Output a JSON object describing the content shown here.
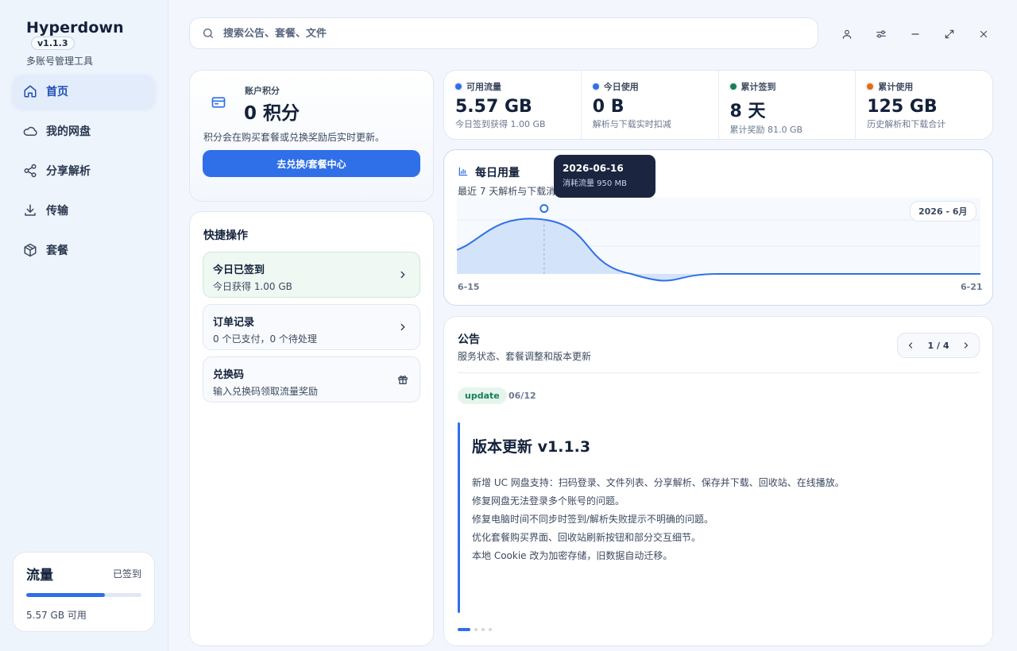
{
  "app": {
    "title": "Hyperdown",
    "version": "v1.1.3",
    "subtitle": "多账号管理工具"
  },
  "nav": {
    "items": [
      {
        "label": "首页",
        "icon": "home-icon",
        "active": true
      },
      {
        "label": "我的网盘",
        "icon": "cloud-icon",
        "active": false
      },
      {
        "label": "分享解析",
        "icon": "share-icon",
        "active": false
      },
      {
        "label": "传输",
        "icon": "download-icon",
        "active": false
      },
      {
        "label": "套餐",
        "icon": "package-icon",
        "active": false
      }
    ]
  },
  "flow": {
    "title": "流量",
    "status": "已签到",
    "available": "5.57 GB 可用",
    "progress": 0.68
  },
  "search": {
    "placeholder": "搜索公告、套餐、文件"
  },
  "window": {
    "icons": [
      "user-icon",
      "settings-sliders-icon",
      "minimize-icon",
      "maximize-icon",
      "close-icon"
    ]
  },
  "points": {
    "label": "账户积分",
    "value": "0 积分",
    "desc": "积分会在购买套餐或兑换奖励后实时更新。",
    "button": "去兑换/套餐中心"
  },
  "quick": {
    "title": "快捷操作",
    "items": [
      {
        "title": "今日已签到",
        "sub": "今日获得 1.00 GB",
        "icon": "chevron-right-icon"
      },
      {
        "title": "订单记录",
        "sub": "0 个已支付，0 个待处理",
        "icon": "chevron-right-icon"
      },
      {
        "title": "兑换码",
        "sub": "输入兑换码领取流量奖励",
        "icon": "gift-icon"
      }
    ]
  },
  "stats": [
    {
      "label": "可用流量",
      "value": "5.57 GB",
      "sub": "今日签到获得 1.00 GB",
      "color": "#2f6fe8"
    },
    {
      "label": "今日使用",
      "value": "0 B",
      "sub": "解析与下载实时扣减",
      "color": "#2f6fe8"
    },
    {
      "label": "累计签到",
      "value": "8 天",
      "sub": "累计奖励 81.0 GB",
      "color": "#14805a"
    },
    {
      "label": "累计使用",
      "value": "125 GB",
      "sub": "历史解析和下载合计",
      "color": "#e06d1b"
    }
  ],
  "chart": {
    "title": "每日用量",
    "subtitle": "最近 7 天解析与下载消耗",
    "month": "2026 - 6月",
    "x_start": "6-15",
    "x_end": "6-21",
    "tooltip": {
      "date": "2026-06-16",
      "value": "消耗流量 950 MB"
    }
  },
  "chart_data": {
    "type": "area",
    "x": [
      "6-15",
      "6-16",
      "6-17",
      "6-18",
      "6-19",
      "6-20",
      "6-21"
    ],
    "series": [
      {
        "values": [
          420,
          950,
          0,
          0,
          0,
          0,
          0
        ]
      }
    ]
  },
  "notice": {
    "title": "公告",
    "subtitle": "服务状态、套餐调整和版本更新",
    "page": "1 / 4",
    "tag": "update",
    "date": "06/12",
    "heading": "版本更新 v1.1.3",
    "lines": [
      "新增 UC 网盘支持：扫码登录、文件列表、分享解析、保存并下载、回收站、在线播放。",
      "修复网盘无法登录多个账号的问题。",
      "修复电脑时间不同步时签到/解析失败提示不明确的问题。",
      "优化套餐购买界面、回收站刷新按钮和部分交互细节。",
      "本地 Cookie 改为加密存储，旧数据自动迁移。"
    ]
  }
}
